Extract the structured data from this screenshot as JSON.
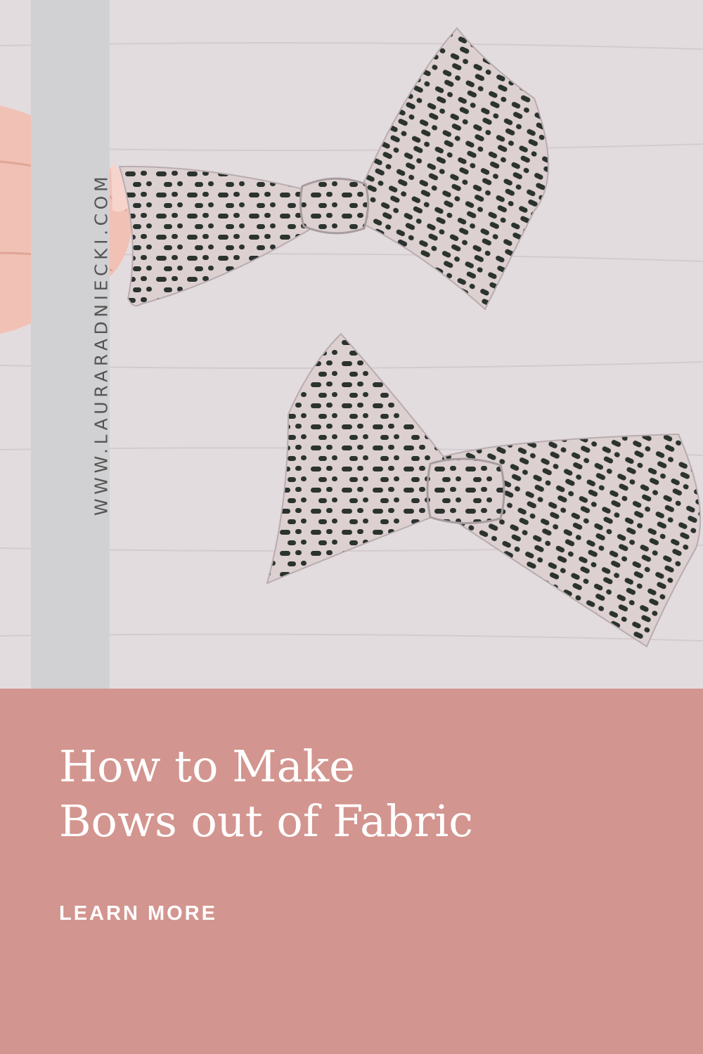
{
  "colors": {
    "panel_background": "#d3958f",
    "side_band": "#d1d1d3",
    "photo_background": "#e3dcde",
    "fabric_base": "#ddd0d0",
    "fabric_dots": "#2b332f",
    "title_text": "#ffffff",
    "url_text": "#555555"
  },
  "photo": {
    "side_band": {
      "url": "WWW.LAURARADNIECKI.COM"
    }
  },
  "panel": {
    "title_line1": "How to Make",
    "title_line2": "Bows out of Fabric",
    "cta_label": "LEARN MORE"
  }
}
